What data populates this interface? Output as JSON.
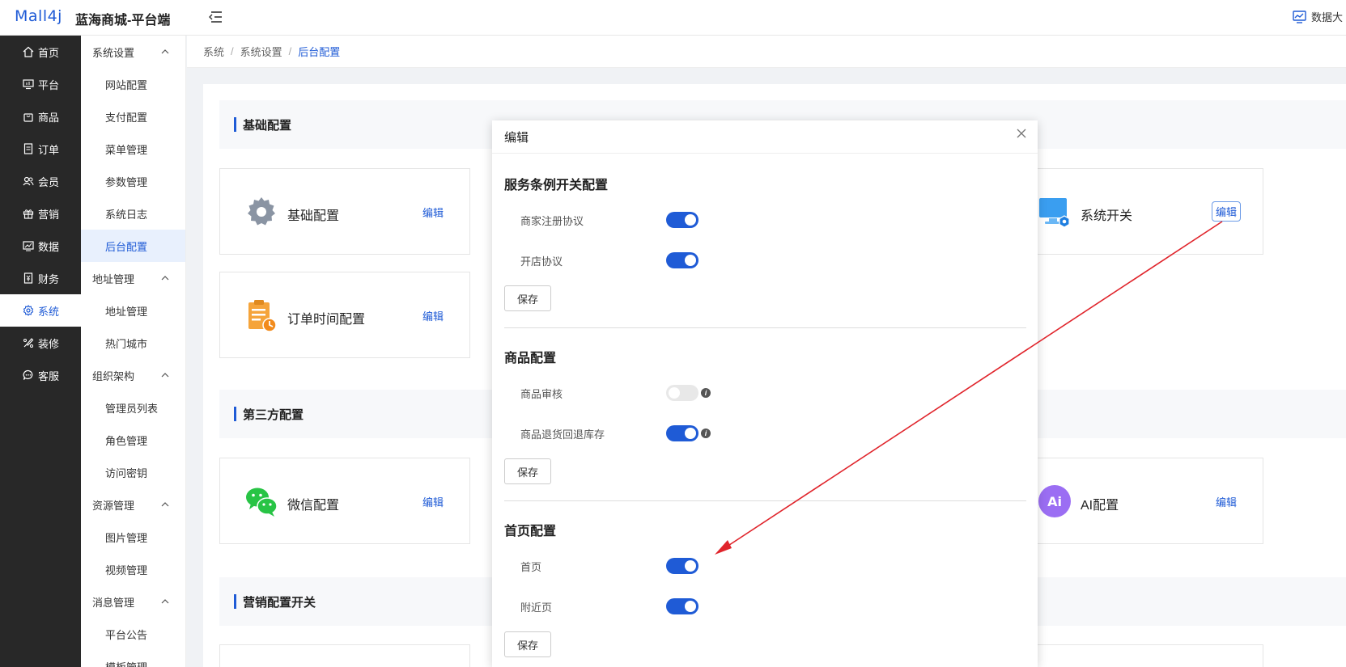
{
  "header": {
    "logo": "Mall4j",
    "app_title": "蓝海商城-平台端",
    "right_label": "数据大"
  },
  "sidebar": {
    "items": [
      {
        "label": "首页",
        "icon": "home-icon"
      },
      {
        "label": "平台",
        "icon": "monitor-icon"
      },
      {
        "label": "商品",
        "icon": "bag-icon"
      },
      {
        "label": "订单",
        "icon": "document-icon"
      },
      {
        "label": "会员",
        "icon": "users-icon"
      },
      {
        "label": "营销",
        "icon": "gift-icon"
      },
      {
        "label": "数据",
        "icon": "chart-icon"
      },
      {
        "label": "财务",
        "icon": "finance-icon"
      },
      {
        "label": "系统",
        "icon": "gear-icon"
      },
      {
        "label": "装修",
        "icon": "brush-icon"
      },
      {
        "label": "客服",
        "icon": "chat-icon"
      }
    ]
  },
  "subsidebar": {
    "groups": [
      {
        "label": "系统设置",
        "items": [
          "网站配置",
          "支付配置",
          "菜单管理",
          "参数管理",
          "系统日志",
          "后台配置"
        ]
      },
      {
        "label": "地址管理",
        "items": [
          "地址管理",
          "热门城市"
        ]
      },
      {
        "label": "组织架构",
        "items": [
          "管理员列表",
          "角色管理",
          "访问密钥"
        ]
      },
      {
        "label": "资源管理",
        "items": [
          "图片管理",
          "视频管理"
        ]
      },
      {
        "label": "消息管理",
        "items": [
          "平台公告",
          "模板管理"
        ]
      }
    ]
  },
  "breadcrumb": [
    "系统",
    "系统设置",
    "后台配置"
  ],
  "sections": {
    "basic": "基础配置",
    "third": "第三方配置",
    "marketing": "营销配置开关"
  },
  "cards": {
    "basic": {
      "title": "基础配置",
      "edit": "编辑"
    },
    "order_time": {
      "title": "订单时间配置",
      "edit": "编辑"
    },
    "system_switch": {
      "title": "系统开关",
      "edit": "编辑"
    },
    "wechat": {
      "title": "微信配置",
      "edit": "编辑"
    },
    "ai": {
      "title": "AI配置",
      "edit": "编辑",
      "badge": "Ai"
    }
  },
  "modal": {
    "title": "编辑",
    "sections": [
      {
        "title": "服务条例开关配置",
        "rows": [
          {
            "label": "商家注册协议",
            "on": true
          },
          {
            "label": "开店协议",
            "on": true
          }
        ],
        "save": "保存"
      },
      {
        "title": "商品配置",
        "rows": [
          {
            "label": "商品审核",
            "on": false,
            "info": true
          },
          {
            "label": "商品退货回退库存",
            "on": true,
            "info": true
          }
        ],
        "save": "保存"
      },
      {
        "title": "首页配置",
        "rows": [
          {
            "label": "首页",
            "on": true
          },
          {
            "label": "附近页",
            "on": true
          }
        ],
        "save": "保存"
      }
    ]
  },
  "colors": {
    "accent": "#1f5bd6",
    "sidebar_bg": "#282828",
    "annotation_arrow": "#e0242b"
  }
}
